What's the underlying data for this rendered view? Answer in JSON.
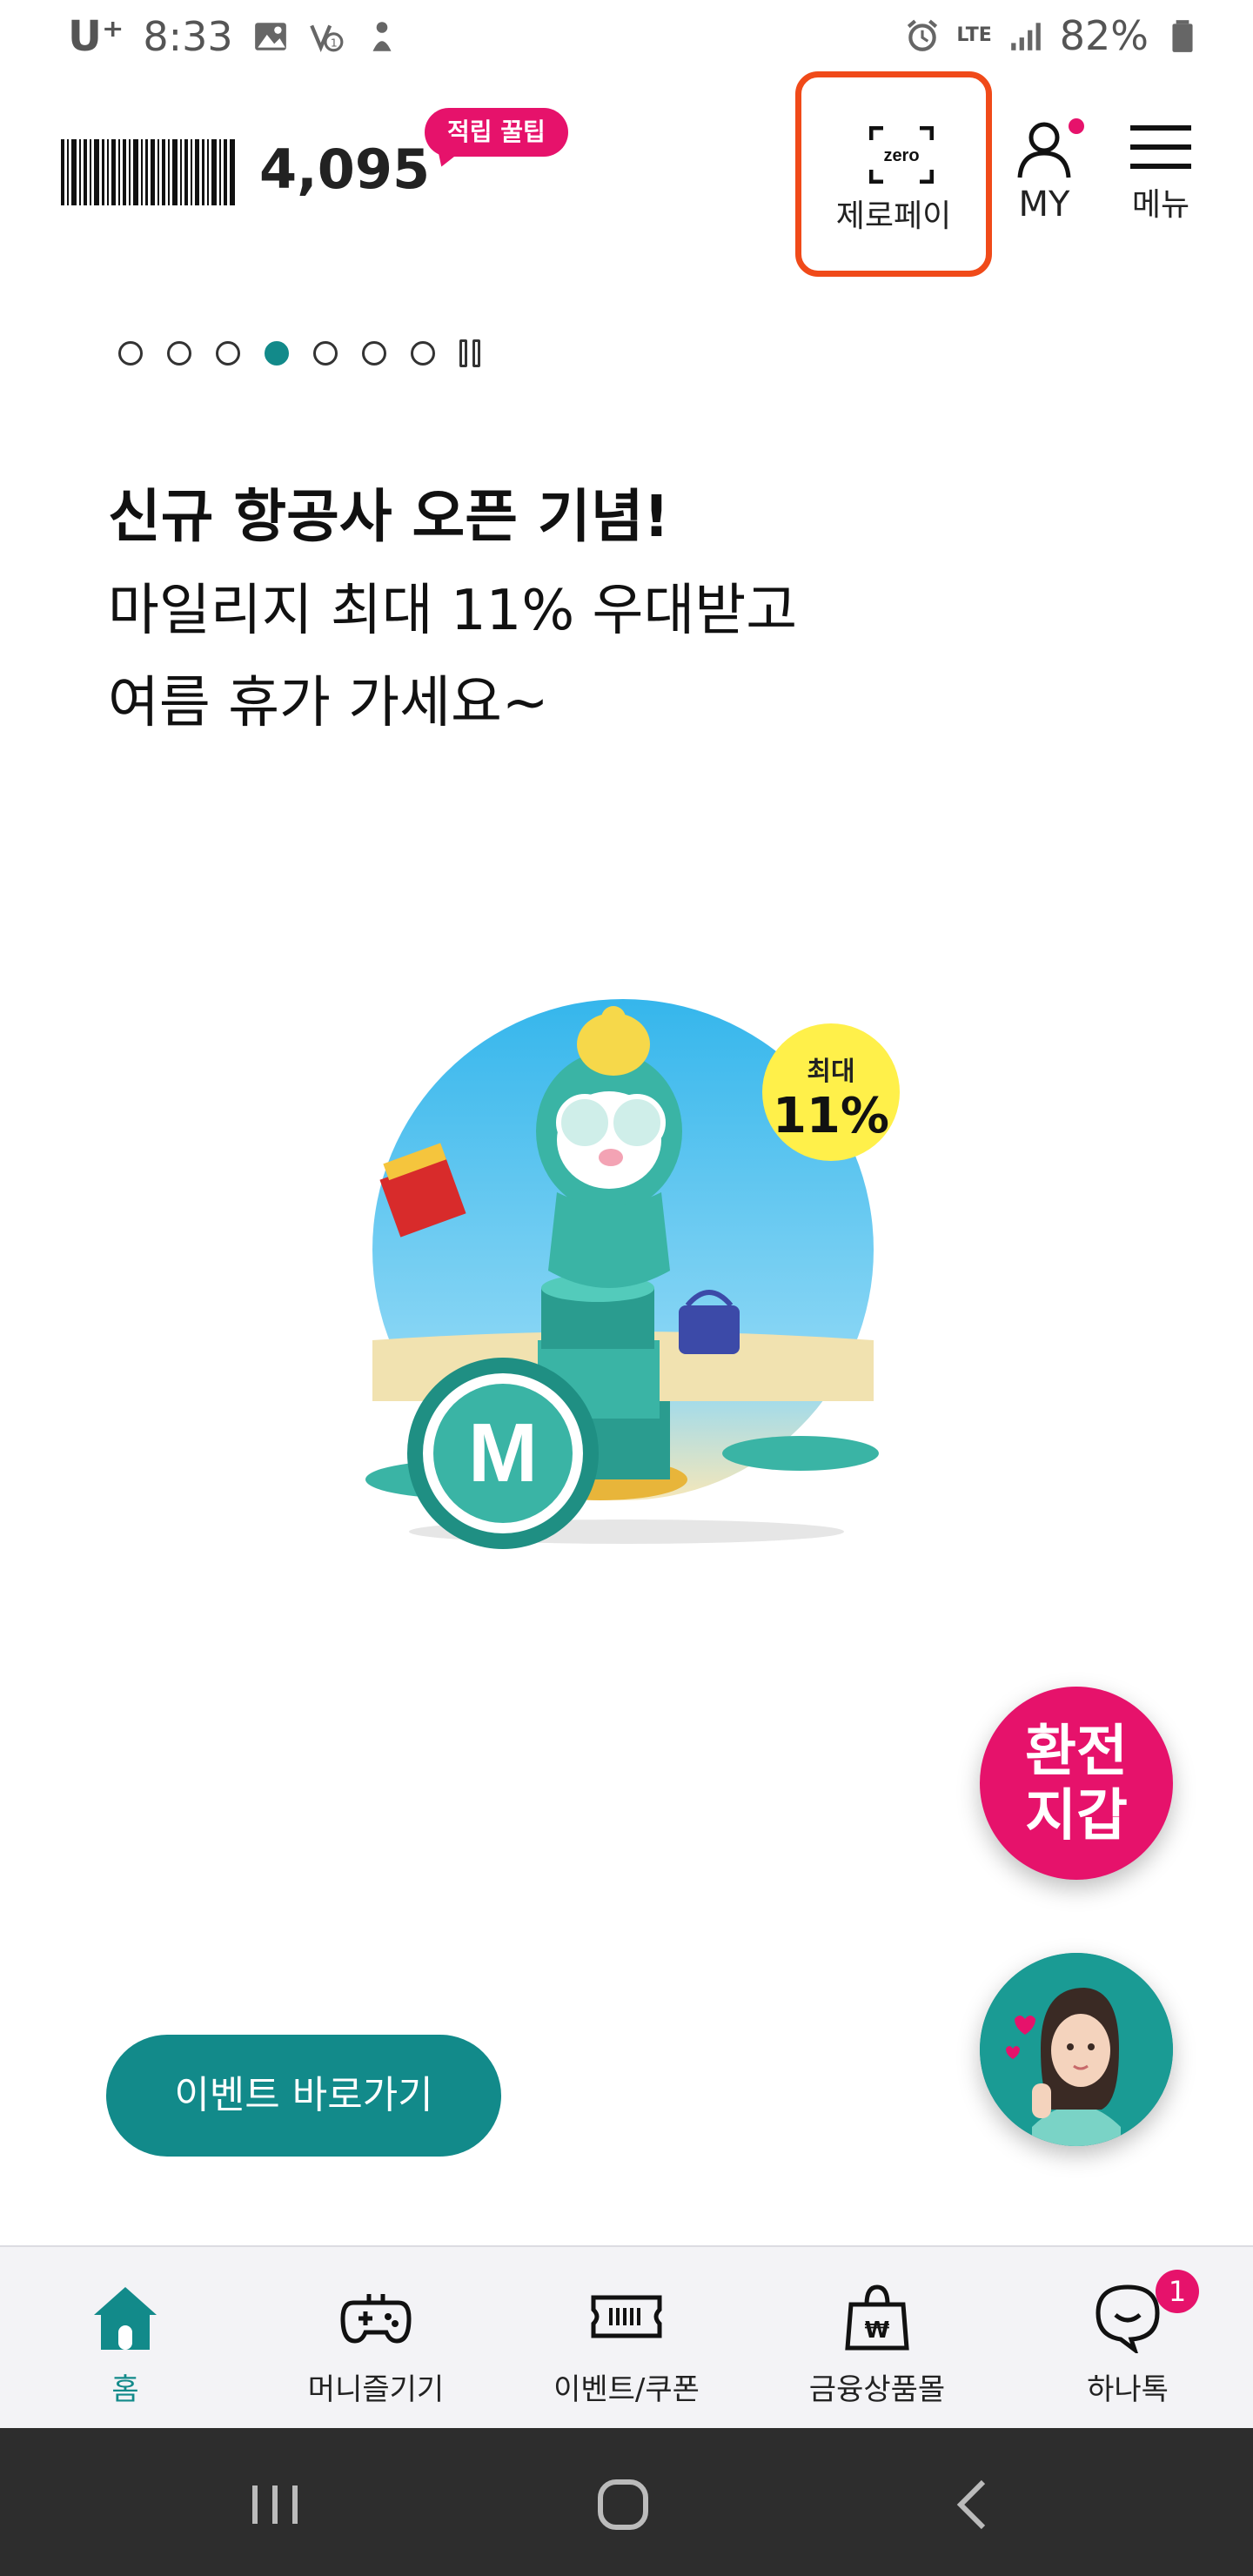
{
  "status_bar": {
    "carrier": "U⁺",
    "time": "8:33",
    "network": "LTE",
    "battery": "82%"
  },
  "header": {
    "points": "4,095",
    "tip_badge": "적립 꿀팁",
    "zeropay_icon_text": "zero",
    "zeropay_label": "제로페이",
    "my_label": "MY",
    "menu_label": "메뉴"
  },
  "pager": {
    "total": 7,
    "active_index": 3
  },
  "banner": {
    "headline": "신규 항공사 오픈 기념!",
    "line1": "마일리지 최대 11% 우대받고",
    "line2": "여름 휴가 가세요~",
    "badge_top": "최대",
    "badge_big": "11%"
  },
  "floating": {
    "exchange_wallet": "환전\n지갑"
  },
  "event_button": "이벤트 바로가기",
  "bottom_nav": {
    "items": [
      {
        "label": "홈",
        "icon": "home-icon",
        "active": true
      },
      {
        "label": "머니즐기기",
        "icon": "gamepad-icon",
        "active": false
      },
      {
        "label": "이벤트/쿠폰",
        "icon": "ticket-icon",
        "active": false
      },
      {
        "label": "금융상품몰",
        "icon": "shopping-bag-won-icon",
        "active": false
      },
      {
        "label": "하나톡",
        "icon": "chat-icon",
        "active": false,
        "badge": "1"
      }
    ]
  },
  "colors": {
    "teal": "#128a8a",
    "pink": "#e6126b",
    "highlight": "#f04a19"
  }
}
